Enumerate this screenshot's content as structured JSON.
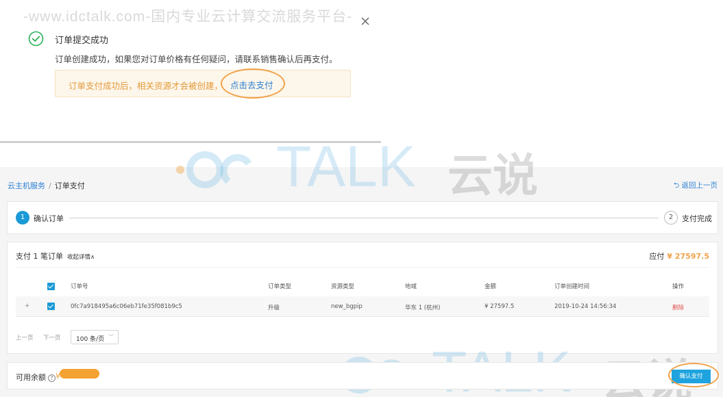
{
  "watermark": {
    "url_text": "-www.idctalk.com-国内专业云计算交流服务平台-",
    "logo_text": "TALK",
    "logo_cn": "云说"
  },
  "dialog": {
    "title": "订单提交成功",
    "description": "订单创建成功，如果您对订单价格有任何疑问，请联系销售确认后再支付。",
    "notice_text": "订单支付成功后，相关资源才会被创建，",
    "pay_link": "点击去支付",
    "close_icon": "close-icon",
    "status_icon": "check-circle-icon"
  },
  "breadcrumb": {
    "parent": "云主机服务",
    "separator": "/",
    "current": "订单支付",
    "back_link": "返回上一页"
  },
  "steps": [
    {
      "number": "1",
      "label": "确认订单",
      "active": true
    },
    {
      "number": "2",
      "label": "支付完成",
      "active": false
    }
  ],
  "orders": {
    "title": "支付 1 笔订单",
    "collapse_link": "收起详情∧",
    "due_label": "应付",
    "due_amount": "¥ 27597.5",
    "columns": [
      "订单号",
      "订单类型",
      "资源类型",
      "地域",
      "金额",
      "订单创建时间",
      "操作"
    ],
    "rows": [
      {
        "expand": "+",
        "order_no": "0fc7a918495a6c06eb71fe35f081b9c5",
        "order_type": "升级",
        "resource_type": "new_bgpip",
        "region": "华东 1 (杭州)",
        "amount": "¥ 27597.5",
        "created_at": "2019-10-24 14:56:34",
        "action": "删除"
      }
    ],
    "pager": {
      "prev": "上一页",
      "next": "下一页",
      "page_size": "100 条/页"
    }
  },
  "balance": {
    "label": "可用余额",
    "value": "¥",
    "confirm_button": "确认支付"
  },
  "colors": {
    "primary": "#1b9ad6",
    "link": "#2b7fd4",
    "warning": "#f0a24a",
    "success": "#2bb35a",
    "danger": "#e05050"
  }
}
